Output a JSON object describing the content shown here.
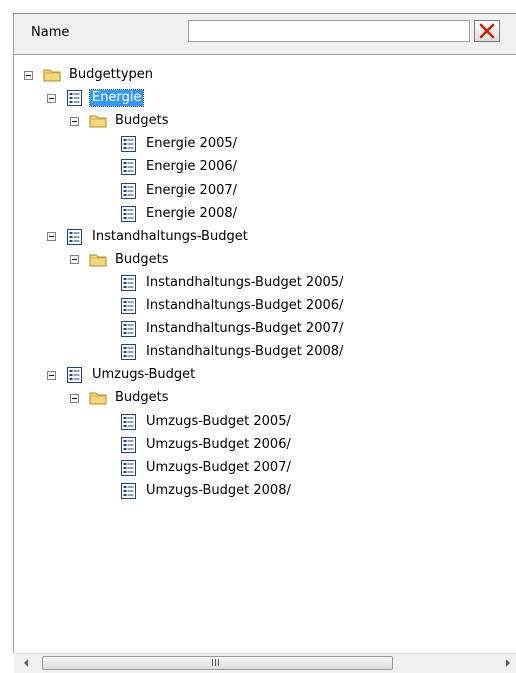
{
  "filter": {
    "label": "Name",
    "value": "",
    "placeholder": ""
  },
  "tree": {
    "root": {
      "label": "Budgettypen"
    },
    "types": [
      {
        "label": "Energie",
        "selected": true,
        "folder": "Budgets",
        "budgets": [
          "Energie 2005/",
          "Energie 2006/",
          "Energie 2007/",
          "Energie 2008/"
        ]
      },
      {
        "label": "Instandhaltungs-Budget",
        "selected": false,
        "folder": "Budgets",
        "budgets": [
          "Instandhaltungs-Budget 2005/",
          "Instandhaltungs-Budget 2006/",
          "Instandhaltungs-Budget 2007/",
          "Instandhaltungs-Budget 2008/"
        ]
      },
      {
        "label": "Umzugs-Budget",
        "selected": false,
        "folder": "Budgets",
        "budgets": [
          "Umzugs-Budget 2005/",
          "Umzugs-Budget 2006/",
          "Umzugs-Budget 2007/",
          "Umzugs-Budget 2008/"
        ]
      }
    ]
  },
  "scrollbar": {
    "grip": "III"
  },
  "colors": {
    "selection": "#3399ff",
    "folder": "#f5d67a",
    "clear_icon": "#cc2200"
  },
  "icons": {
    "folder": "folder-icon",
    "budget_type": "list-icon",
    "budget": "list-icon",
    "clear": "close-icon"
  }
}
